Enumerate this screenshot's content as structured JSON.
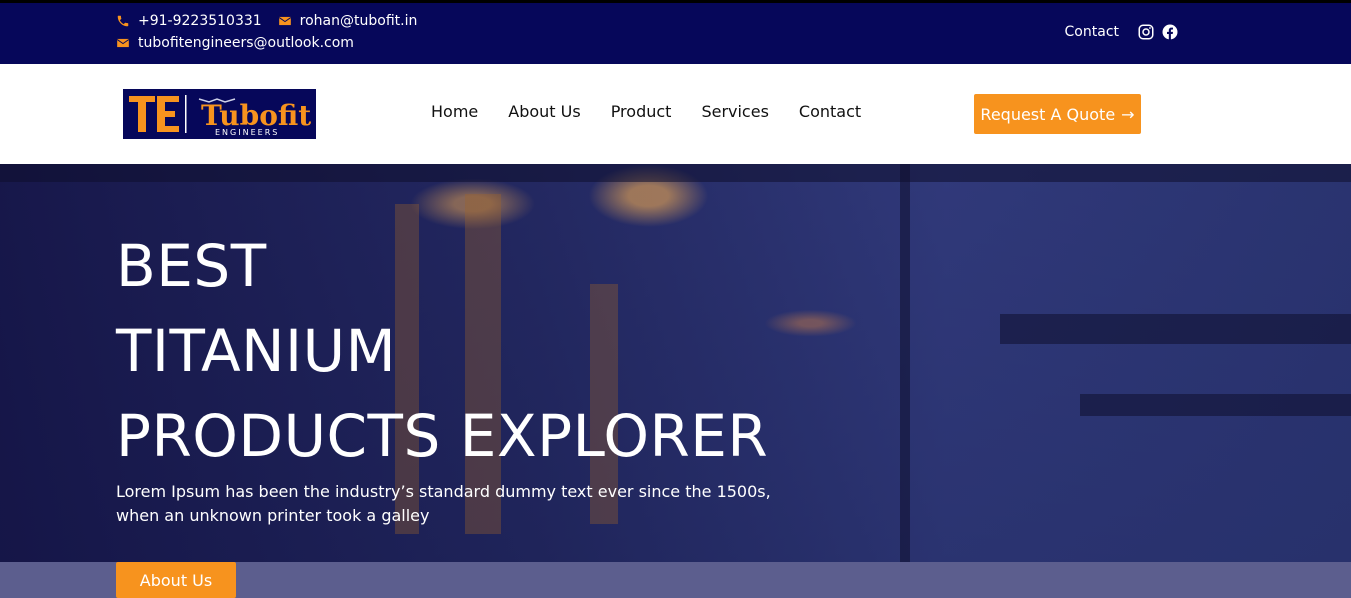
{
  "topbar": {
    "phone": "+91-9223510331",
    "email1": "rohan@tubofit.in",
    "email2": "tubofitengineers@outlook.com",
    "contact_label": "Contact",
    "icons": {
      "phone": "phone-icon",
      "mail": "envelope-icon",
      "instagram": "instagram-icon",
      "facebook": "facebook-icon"
    }
  },
  "header": {
    "logo": {
      "letters": "TE",
      "brand": "Tubofit",
      "sub": "ENGINEERS"
    },
    "nav": [
      "Home",
      "About Us",
      "Product",
      "Services",
      "Contact"
    ],
    "quote_label": "Request A Quote",
    "quote_icon": "arrow-right-icon"
  },
  "hero": {
    "title_line1": "BEST",
    "title_line2": "TITANIUM",
    "title_line3": "PRODUCTS EXPLORER",
    "text": "Lorem Ipsum has been the industry’s standard dummy text ever since the 1500s, when an unknown printer took a galley"
  },
  "strip": {
    "about_label": "About Us"
  },
  "colors": {
    "navy": "#06075a",
    "accent": "#f7931e",
    "strip": "#5c5e8e"
  }
}
